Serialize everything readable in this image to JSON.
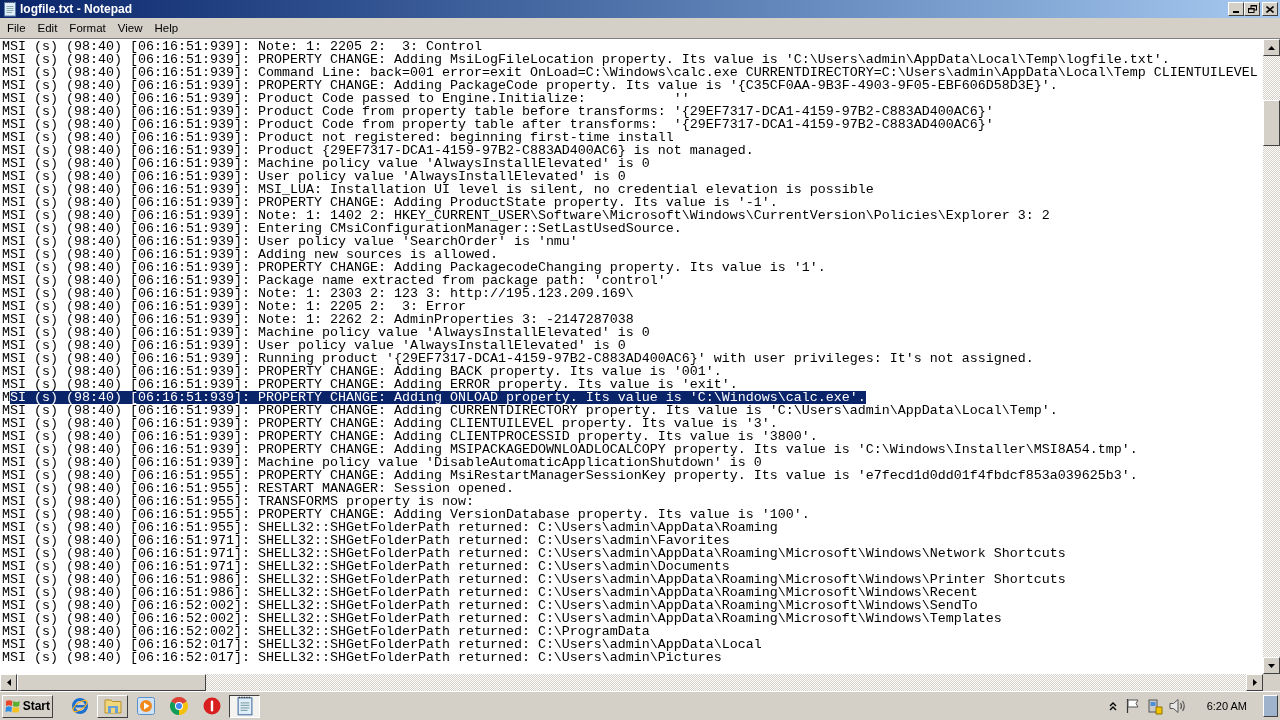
{
  "window": {
    "title": "logfile.txt - Notepad"
  },
  "menu": [
    "File",
    "Edit",
    "Format",
    "View",
    "Help"
  ],
  "lines": [
    {
      "text": "MSI (s) (98:40) [06:16:51:939]: Note: 1: 2205 2:  3: Control",
      "selected": false
    },
    {
      "text": "MSI (s) (98:40) [06:16:51:939]: PROPERTY CHANGE: Adding MsiLogFileLocation property. Its value is 'C:\\Users\\admin\\AppData\\Local\\Temp\\logfile.txt'.",
      "selected": false
    },
    {
      "text": "MSI (s) (98:40) [06:16:51:939]: Command Line: back=001 error=exit OnLoad=C:\\Windows\\calc.exe CURRENTDIRECTORY=C:\\Users\\admin\\AppData\\Local\\Temp CLIENTUILEVEL",
      "selected": false
    },
    {
      "text": "MSI (s) (98:40) [06:16:51:939]: PROPERTY CHANGE: Adding PackageCode property. Its value is '{C35CF0AA-9B3F-4903-9F05-EBF606D58D3E}'.",
      "selected": false
    },
    {
      "text": "MSI (s) (98:40) [06:16:51:939]: Product Code passed to Engine.Initialize:           ''",
      "selected": false
    },
    {
      "text": "MSI (s) (98:40) [06:16:51:939]: Product Code from property table before transforms: '{29EF7317-DCA1-4159-97B2-C883AD400AC6}'",
      "selected": false
    },
    {
      "text": "MSI (s) (98:40) [06:16:51:939]: Product Code from property table after transforms:  '{29EF7317-DCA1-4159-97B2-C883AD400AC6}'",
      "selected": false
    },
    {
      "text": "MSI (s) (98:40) [06:16:51:939]: Product not registered: beginning first-time install",
      "selected": false
    },
    {
      "text": "MSI (s) (98:40) [06:16:51:939]: Product {29EF7317-DCA1-4159-97B2-C883AD400AC6} is not managed.",
      "selected": false
    },
    {
      "text": "MSI (s) (98:40) [06:16:51:939]: Machine policy value 'AlwaysInstallElevated' is 0",
      "selected": false
    },
    {
      "text": "MSI (s) (98:40) [06:16:51:939]: User policy value 'AlwaysInstallElevated' is 0",
      "selected": false
    },
    {
      "text": "MSI (s) (98:40) [06:16:51:939]: MSI_LUA: Installation UI level is silent, no credential elevation is possible",
      "selected": false
    },
    {
      "text": "MSI (s) (98:40) [06:16:51:939]: PROPERTY CHANGE: Adding ProductState property. Its value is '-1'.",
      "selected": false
    },
    {
      "text": "MSI (s) (98:40) [06:16:51:939]: Note: 1: 1402 2: HKEY_CURRENT_USER\\Software\\Microsoft\\Windows\\CurrentVersion\\Policies\\Explorer 3: 2",
      "selected": false
    },
    {
      "text": "MSI (s) (98:40) [06:16:51:939]: Entering CMsiConfigurationManager::SetLastUsedSource.",
      "selected": false
    },
    {
      "text": "MSI (s) (98:40) [06:16:51:939]: User policy value 'SearchOrder' is 'nmu'",
      "selected": false
    },
    {
      "text": "MSI (s) (98:40) [06:16:51:939]: Adding new sources is allowed.",
      "selected": false
    },
    {
      "text": "MSI (s) (98:40) [06:16:51:939]: PROPERTY CHANGE: Adding PackagecodeChanging property. Its value is '1'.",
      "selected": false
    },
    {
      "text": "MSI (s) (98:40) [06:16:51:939]: Package name extracted from package path: 'control'",
      "selected": false
    },
    {
      "text": "MSI (s) (98:40) [06:16:51:939]: Note: 1: 2303 2: 123 3: http://195.123.209.169\\",
      "selected": false
    },
    {
      "text": "MSI (s) (98:40) [06:16:51:939]: Note: 1: 2205 2:  3: Error",
      "selected": false
    },
    {
      "text": "MSI (s) (98:40) [06:16:51:939]: Note: 1: 2262 2: AdminProperties 3: -2147287038",
      "selected": false
    },
    {
      "text": "MSI (s) (98:40) [06:16:51:939]: Machine policy value 'AlwaysInstallElevated' is 0",
      "selected": false
    },
    {
      "text": "MSI (s) (98:40) [06:16:51:939]: User policy value 'AlwaysInstallElevated' is 0",
      "selected": false
    },
    {
      "text": "MSI (s) (98:40) [06:16:51:939]: Running product '{29EF7317-DCA1-4159-97B2-C883AD400AC6}' with user privileges: It's not assigned.",
      "selected": false
    },
    {
      "text": "MSI (s) (98:40) [06:16:51:939]: PROPERTY CHANGE: Adding BACK property. Its value is '001'.",
      "selected": false
    },
    {
      "text": "MSI (s) (98:40) [06:16:51:939]: PROPERTY CHANGE: Adding ERROR property. Its value is 'exit'.",
      "selected": false
    },
    {
      "text": "M",
      "selected_part": "SI (s) (98:40) [06:16:51:939]: PROPERTY CHANGE: Adding ONLOAD property. Its value is 'C:\\Windows\\calc.exe'.",
      "selected": true
    },
    {
      "text": "MSI (s) (98:40) [06:16:51:939]: PROPERTY CHANGE: Adding CURRENTDIRECTORY property. Its value is 'C:\\Users\\admin\\AppData\\Local\\Temp'.",
      "selected": false
    },
    {
      "text": "MSI (s) (98:40) [06:16:51:939]: PROPERTY CHANGE: Adding CLIENTUILEVEL property. Its value is '3'.",
      "selected": false
    },
    {
      "text": "MSI (s) (98:40) [06:16:51:939]: PROPERTY CHANGE: Adding CLIENTPROCESSID property. Its value is '3800'.",
      "selected": false
    },
    {
      "text": "MSI (s) (98:40) [06:16:51:939]: PROPERTY CHANGE: Adding MSIPACKAGEDOWNLOADLOCALCOPY property. Its value is 'C:\\Windows\\Installer\\MSI8A54.tmp'.",
      "selected": false
    },
    {
      "text": "MSI (s) (98:40) [06:16:51:939]: Machine policy value 'DisableAutomaticApplicationShutdown' is 0",
      "selected": false
    },
    {
      "text": "MSI (s) (98:40) [06:16:51:955]: PROPERTY CHANGE: Adding MsiRestartManagerSessionKey property. Its value is 'e7fecd1d0dd01f4fbdcf853a039625b3'.",
      "selected": false
    },
    {
      "text": "MSI (s) (98:40) [06:16:51:955]: RESTART MANAGER: Session opened.",
      "selected": false
    },
    {
      "text": "MSI (s) (98:40) [06:16:51:955]: TRANSFORMS property is now:",
      "selected": false
    },
    {
      "text": "MSI (s) (98:40) [06:16:51:955]: PROPERTY CHANGE: Adding VersionDatabase property. Its value is '100'.",
      "selected": false
    },
    {
      "text": "MSI (s) (98:40) [06:16:51:955]: SHELL32::SHGetFolderPath returned: C:\\Users\\admin\\AppData\\Roaming",
      "selected": false
    },
    {
      "text": "MSI (s) (98:40) [06:16:51:971]: SHELL32::SHGetFolderPath returned: C:\\Users\\admin\\Favorites",
      "selected": false
    },
    {
      "text": "MSI (s) (98:40) [06:16:51:971]: SHELL32::SHGetFolderPath returned: C:\\Users\\admin\\AppData\\Roaming\\Microsoft\\Windows\\Network Shortcuts",
      "selected": false
    },
    {
      "text": "MSI (s) (98:40) [06:16:51:971]: SHELL32::SHGetFolderPath returned: C:\\Users\\admin\\Documents",
      "selected": false
    },
    {
      "text": "MSI (s) (98:40) [06:16:51:986]: SHELL32::SHGetFolderPath returned: C:\\Users\\admin\\AppData\\Roaming\\Microsoft\\Windows\\Printer Shortcuts",
      "selected": false
    },
    {
      "text": "MSI (s) (98:40) [06:16:51:986]: SHELL32::SHGetFolderPath returned: C:\\Users\\admin\\AppData\\Roaming\\Microsoft\\Windows\\Recent",
      "selected": false
    },
    {
      "text": "MSI (s) (98:40) [06:16:52:002]: SHELL32::SHGetFolderPath returned: C:\\Users\\admin\\AppData\\Roaming\\Microsoft\\Windows\\SendTo",
      "selected": false
    },
    {
      "text": "MSI (s) (98:40) [06:16:52:002]: SHELL32::SHGetFolderPath returned: C:\\Users\\admin\\AppData\\Roaming\\Microsoft\\Windows\\Templates",
      "selected": false
    },
    {
      "text": "MSI (s) (98:40) [06:16:52:002]: SHELL32::SHGetFolderPath returned: C:\\ProgramData",
      "selected": false
    },
    {
      "text": "MSI (s) (98:40) [06:16:52:017]: SHELL32::SHGetFolderPath returned: C:\\Users\\admin\\AppData\\Local",
      "selected": false
    },
    {
      "text": "MSI (s) (98:40) [06:16:52:017]: SHELL32::SHGetFolderPath returned: C:\\Users\\admin\\Pictures",
      "selected": false
    }
  ],
  "taskbar": {
    "start": "Start",
    "items": [
      {
        "kind": "globe",
        "open": false,
        "selected": false
      },
      {
        "kind": "folder",
        "open": true,
        "selected": false
      },
      {
        "kind": "play",
        "open": false,
        "selected": false
      },
      {
        "kind": "round",
        "open": false,
        "selected": false
      },
      {
        "kind": "disc",
        "open": false,
        "selected": false
      },
      {
        "kind": "notepad",
        "open": true,
        "selected": true
      }
    ],
    "clock": "6:20 AM"
  }
}
